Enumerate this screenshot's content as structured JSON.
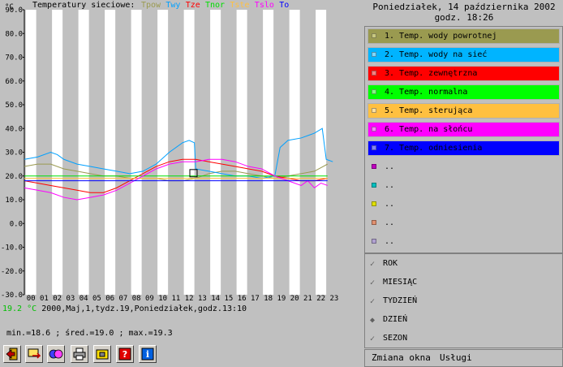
{
  "chart_data": {
    "type": "line",
    "title": "Temperatury sieciowe:",
    "y_unit": "°C",
    "ylim": [
      -30,
      90
    ],
    "y_ticks": [
      "90.0",
      "80.0",
      "70.0",
      "60.0",
      "50.0",
      "40.0",
      "30.0",
      "20.0",
      "10.0",
      "0.0",
      "-10.0",
      "-20.0",
      "-30.0"
    ],
    "x_ticks": [
      "00",
      "01",
      "02",
      "03",
      "04",
      "05",
      "06",
      "07",
      "08",
      "09",
      "10",
      "11",
      "12",
      "13",
      "14",
      "15",
      "16",
      "17",
      "18",
      "19",
      "20",
      "21",
      "22",
      "23"
    ],
    "xlim": [
      0,
      24
    ],
    "series": [
      {
        "name": "Tpow",
        "color": "#9a9a50",
        "x": [
          0,
          1,
          2,
          3,
          4,
          5,
          6,
          7,
          8,
          9,
          10,
          11,
          12,
          13,
          14,
          15,
          16,
          17,
          18,
          19,
          20,
          21,
          22,
          23
        ],
        "values": [
          24,
          25,
          25,
          23,
          22,
          21,
          20,
          20,
          19,
          19,
          19,
          18,
          18,
          19,
          21,
          22,
          22,
          21,
          20,
          19,
          20,
          21,
          22,
          25
        ]
      },
      {
        "name": "Twy",
        "color": "#00a0ff",
        "x": [
          0,
          1,
          2,
          2.5,
          3,
          4,
          5,
          6,
          7,
          8,
          9,
          10,
          11,
          12,
          12.5,
          12.9,
          13,
          14,
          15,
          16,
          17,
          18,
          19,
          19.4,
          20,
          21,
          22,
          22.6,
          22.9,
          23.4
        ],
        "values": [
          27,
          28,
          30,
          29,
          27,
          25,
          24,
          23,
          22,
          21,
          22,
          25,
          30,
          34,
          35,
          34,
          23,
          22,
          21,
          20,
          20,
          19,
          20,
          32,
          35,
          36,
          38,
          40,
          27,
          26
        ]
      },
      {
        "name": "Tze",
        "color": "#ff0000",
        "x": [
          0,
          1,
          2,
          3,
          4,
          5,
          6,
          7,
          8,
          9,
          10,
          11,
          12,
          13,
          14,
          15,
          16,
          17,
          18,
          19,
          20,
          21,
          22,
          23
        ],
        "values": [
          18,
          17,
          16,
          15,
          14,
          13,
          13,
          15,
          18,
          21,
          24,
          26,
          27,
          27,
          26,
          25,
          24,
          23,
          22,
          20,
          19,
          18,
          18,
          19
        ]
      },
      {
        "name": "Tnor",
        "color": "#00e000",
        "x": [
          0,
          1,
          2,
          3,
          4,
          5,
          6,
          7,
          8,
          9,
          10,
          11,
          12,
          13,
          14,
          15,
          16,
          17,
          18,
          19,
          20,
          21,
          22,
          23
        ],
        "values": [
          20,
          20,
          20,
          20,
          20,
          20,
          20,
          20,
          20,
          20,
          20,
          20,
          20,
          20,
          20,
          20,
          20,
          20,
          20,
          20,
          20,
          20,
          20,
          20
        ]
      },
      {
        "name": "Tste",
        "color": "#ffc040",
        "x": [
          0,
          1,
          2,
          3,
          4,
          5,
          6,
          7,
          8,
          9,
          10,
          11,
          12,
          13,
          14,
          15,
          16,
          17,
          18,
          19,
          20,
          21,
          22,
          23
        ],
        "values": [
          19,
          19,
          19,
          19,
          19,
          19,
          19,
          19,
          19,
          19,
          19,
          19,
          19,
          19,
          19,
          19,
          19,
          19,
          19,
          19,
          19,
          19,
          19,
          19
        ]
      },
      {
        "name": "Tslo",
        "color": "#ff00ff",
        "x": [
          0,
          1,
          2,
          3,
          4,
          5,
          6,
          7,
          8,
          9,
          10,
          11,
          12,
          13,
          14,
          15,
          16,
          17,
          18,
          19,
          20,
          21,
          21.5,
          22,
          22.5,
          23
        ],
        "values": [
          15,
          14,
          13,
          11,
          10,
          11,
          12,
          14,
          17,
          20,
          23,
          25,
          26,
          26,
          27,
          27,
          26,
          24,
          23,
          20,
          18,
          16,
          18,
          15,
          17,
          16
        ]
      },
      {
        "name": "To",
        "color": "#0000ff",
        "x": [
          0,
          23
        ],
        "values": [
          18,
          18
        ]
      }
    ],
    "grid": "alternating-columns",
    "cursor": {
      "x": 12.8,
      "y": 21
    }
  },
  "header": {
    "date": "Poniedziałek, 14 października 2002",
    "time": "godz. 18:26"
  },
  "legend": {
    "items": [
      {
        "label": "1. Temp. wody powrotnej",
        "bg": "#9a9a50",
        "fg": "#000000",
        "box": "#c8c880"
      },
      {
        "label": "2. Temp. wody na sieć",
        "bg": "#00b4ff",
        "fg": "#000000",
        "box": "#80d8ff"
      },
      {
        "label": "3. Temp. zewnętrzna",
        "bg": "#ff0000",
        "fg": "#000000",
        "box": "#ff8080"
      },
      {
        "label": "4. Temp. normalna",
        "bg": "#00ff00",
        "fg": "#000000",
        "box": "#80ff80"
      },
      {
        "label": "5. Temp. sterująca",
        "bg": "#ffc040",
        "fg": "#000000",
        "box": "#ffe0a0"
      },
      {
        "label": "6. Temp. na słońcu",
        "bg": "#ff00ff",
        "fg": "#000000",
        "box": "#ff80ff"
      },
      {
        "label": "7. Temp. odniesienia",
        "bg": "#0000ff",
        "fg": "#000000",
        "box": "#8080ff"
      },
      {
        "label": "..",
        "bg": "#c0c0c0",
        "fg": "#000000",
        "box": "#c000c0"
      },
      {
        "label": "..",
        "bg": "#c0c0c0",
        "fg": "#000000",
        "box": "#00c0c0"
      },
      {
        "label": "..",
        "bg": "#c0c0c0",
        "fg": "#000000",
        "box": "#e0e000"
      },
      {
        "label": "..",
        "bg": "#c0c0c0",
        "fg": "#000000",
        "box": "#e09070"
      },
      {
        "label": "..",
        "bg": "#c0c0c0",
        "fg": "#000000",
        "box": "#b0a0d0"
      }
    ]
  },
  "period": {
    "items": [
      {
        "label": "ROK",
        "selected": false
      },
      {
        "label": "MIESIĄC",
        "selected": false
      },
      {
        "label": "TYDZIEŃ",
        "selected": false
      },
      {
        "label": "DZIEŃ",
        "selected": true
      },
      {
        "label": "SEZON",
        "selected": false
      }
    ]
  },
  "menu": {
    "window_change": "Zmiana okna",
    "services": "Usługi"
  },
  "status": {
    "current_value": "19.2 °C",
    "current_context": "2000,Maj,1,tydz.19,Poniedziałek,godz.13:10",
    "stats": "min.=18.6 ; śred.=19.0 ; max.=19.3"
  },
  "toolbar": {
    "buttons": [
      {
        "icon": "exit-icon"
      },
      {
        "icon": "transfer-icon"
      },
      {
        "icon": "refresh-icon"
      },
      {
        "icon": "print-icon"
      },
      {
        "icon": "config-icon"
      },
      {
        "icon": "help-icon"
      },
      {
        "icon": "info-icon"
      }
    ]
  }
}
